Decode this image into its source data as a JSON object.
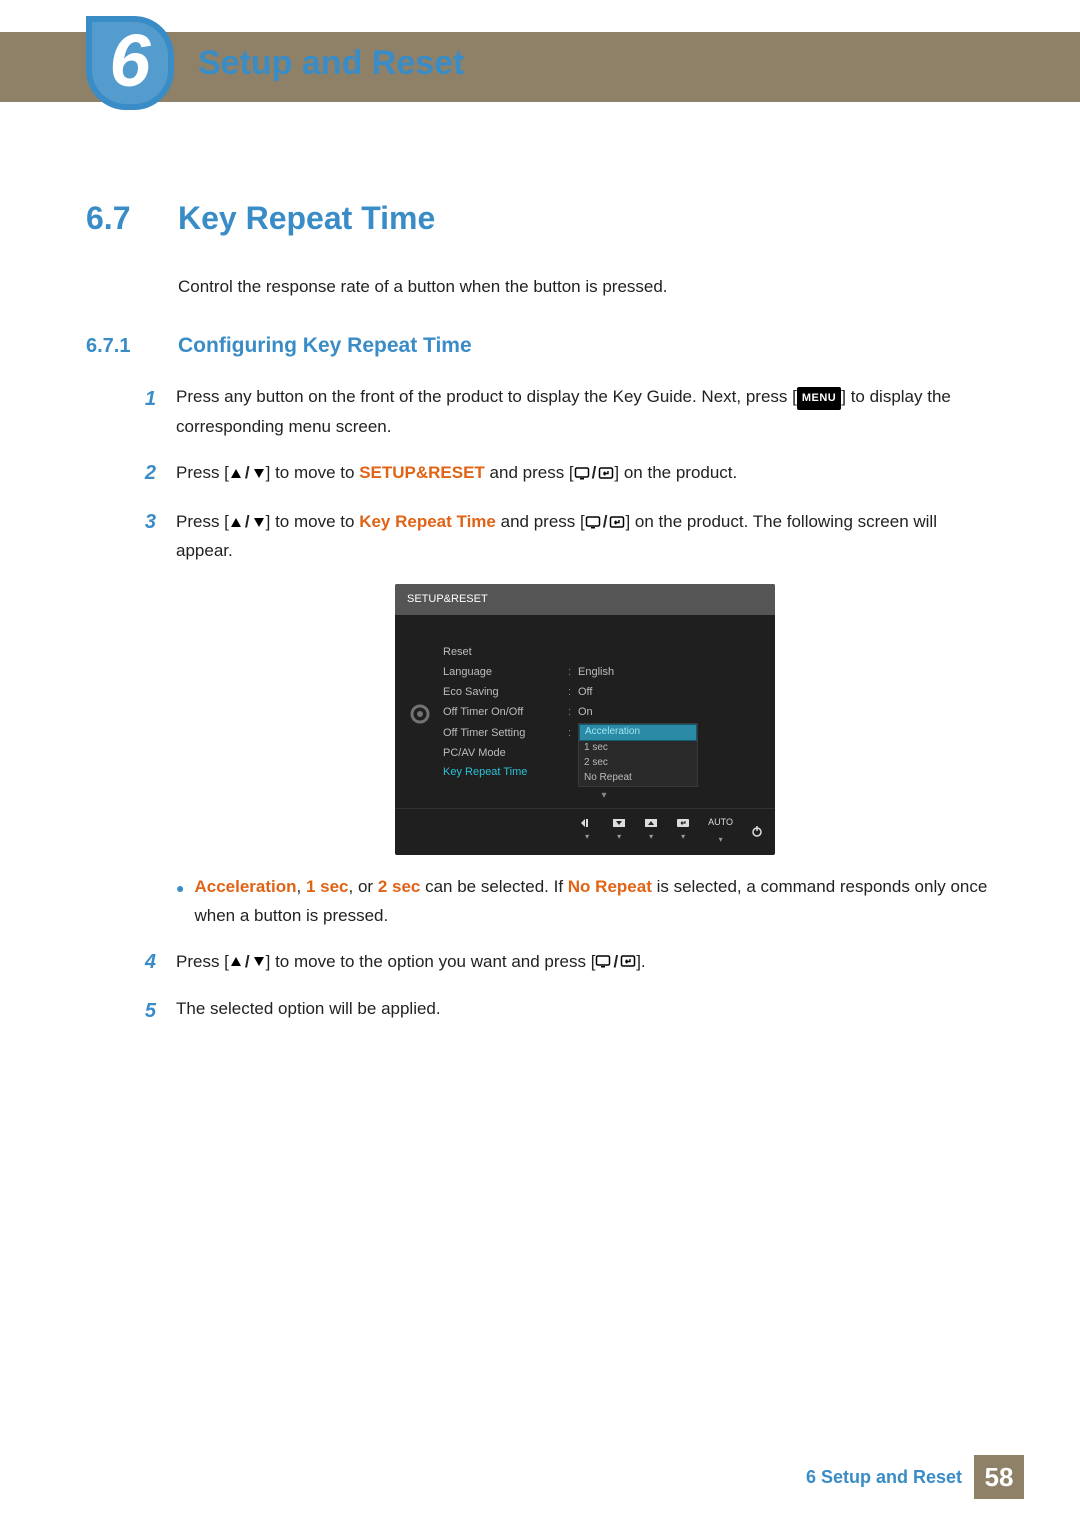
{
  "chapter": {
    "number": "6",
    "title": "Setup and Reset"
  },
  "section": {
    "number": "6.7",
    "title": "Key Repeat Time"
  },
  "intro": "Control the response rate of a button when the button is pressed.",
  "subsection": {
    "number": "6.7.1",
    "title": "Configuring Key Repeat Time"
  },
  "step1": {
    "num": "1",
    "a": "Press any button on the front of the product to display the Key Guide. Next, press [",
    "menu": "MENU",
    "b": "] to display the corresponding menu screen."
  },
  "step2": {
    "num": "2",
    "a": "Press [",
    "b": "] to move to ",
    "hl": "SETUP&RESET",
    "c": " and press [",
    "d": "] on the product."
  },
  "step3": {
    "num": "3",
    "a": "Press [",
    "b": "] to move to ",
    "hl": "Key Repeat Time",
    "c": " and press [",
    "d": "] on the product. The following screen will appear."
  },
  "osd": {
    "header": "SETUP&RESET",
    "rows": {
      "reset": "Reset",
      "language": "Language",
      "language_val": "English",
      "eco": "Eco Saving",
      "eco_val": "Off",
      "timer": "Off Timer On/Off",
      "timer_val": "On",
      "timerset": "Off Timer Setting",
      "pcav": "PC/AV Mode",
      "krt": "Key Repeat Time"
    },
    "dropdown": {
      "sel": "Acceleration",
      "o1": "1 sec",
      "o2": "2 sec",
      "o3": "No Repeat"
    },
    "auto": "AUTO"
  },
  "bullet": {
    "a1": "Acceleration",
    "a2": "1 sec",
    "a3": "2 sec",
    "t1": ", ",
    "t2": ", or ",
    "t3": " can be selected. If ",
    "a4": "No Repeat",
    "t4": " is selected, a command responds only once when a button is pressed."
  },
  "step4": {
    "num": "4",
    "a": "Press [",
    "b": "] to move to the option you want and press [",
    "c": "]."
  },
  "step5": {
    "num": "5",
    "text": "The selected option will be applied."
  },
  "footer": {
    "text": "6 Setup and Reset",
    "page": "58"
  }
}
